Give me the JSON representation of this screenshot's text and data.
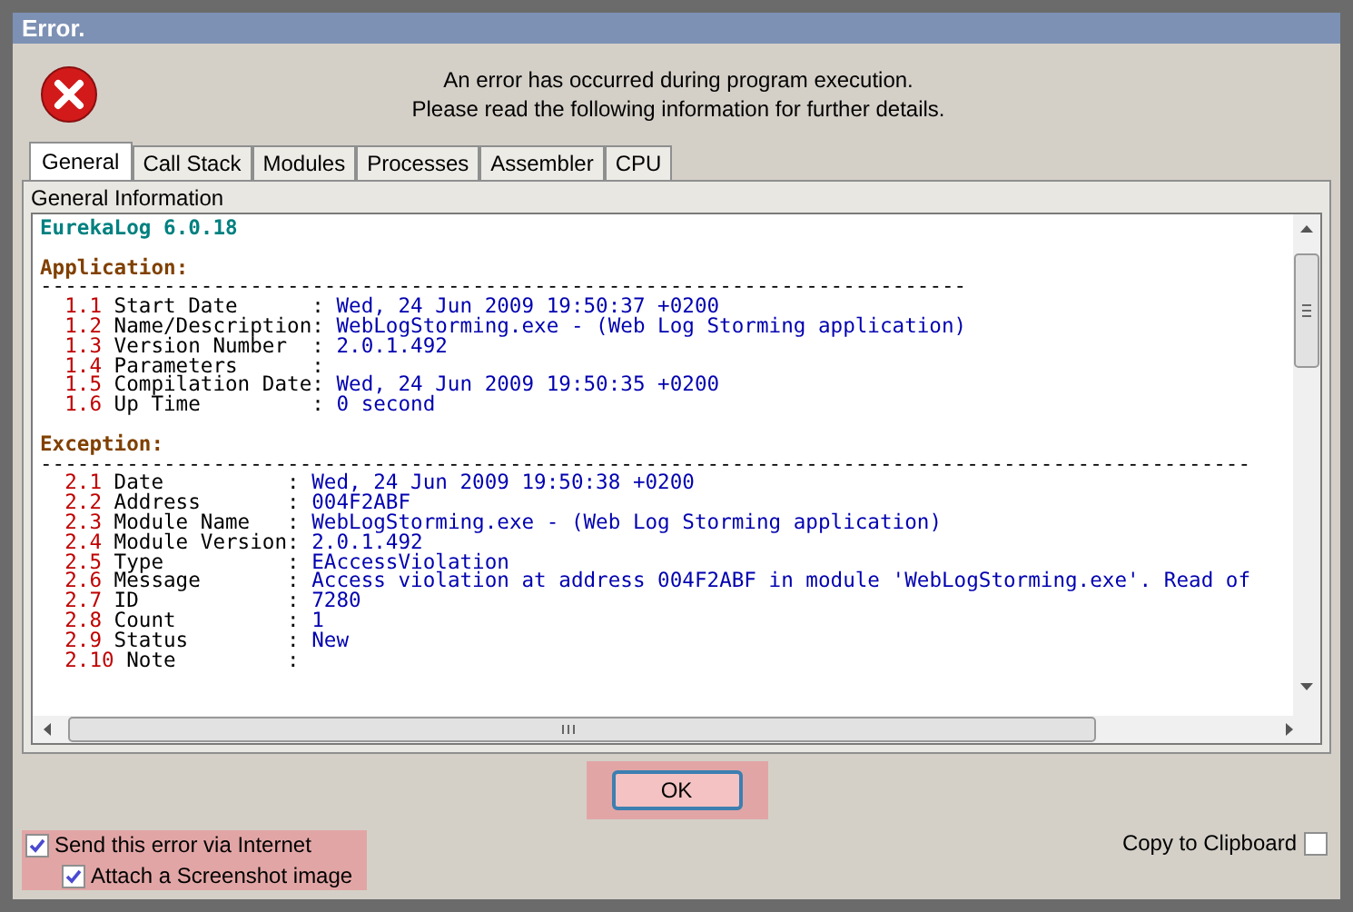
{
  "window": {
    "title": "Error."
  },
  "message": [
    "An error has occurred during program execution.",
    "Please read the following information for further details."
  ],
  "tabs": [
    {
      "label": "General",
      "selected": true
    },
    {
      "label": "Call Stack",
      "selected": false
    },
    {
      "label": "Modules",
      "selected": false
    },
    {
      "label": "Processes",
      "selected": false
    },
    {
      "label": "Assembler",
      "selected": false
    },
    {
      "label": "CPU",
      "selected": false
    }
  ],
  "panel_title": "General Information",
  "log": {
    "title": "EurekaLog 6.0.18",
    "sections": [
      {
        "heading": "Application:",
        "rule": "---------------------------------------------------------------------------",
        "rows": [
          {
            "num": "1.1",
            "label": "Start Date      :",
            "value": "Wed, 24 Jun 2009 19:50:37 +0200"
          },
          {
            "num": "1.2",
            "label": "Name/Description:",
            "value": "WebLogStorming.exe - (Web Log Storming application)"
          },
          {
            "num": "1.3",
            "label": "Version Number  :",
            "value": "2.0.1.492"
          },
          {
            "num": "1.4",
            "label": "Parameters      :",
            "value": ""
          },
          {
            "num": "1.5",
            "label": "Compilation Date:",
            "value": "Wed, 24 Jun 2009 19:50:35 +0200"
          },
          {
            "num": "1.6",
            "label": "Up Time         :",
            "value": "0 second"
          }
        ]
      },
      {
        "heading": "Exception:",
        "rule": "--------------------------------------------------------------------------------------------------",
        "rows": [
          {
            "num": "2.1",
            "label": "Date          :",
            "value": "Wed, 24 Jun 2009 19:50:38 +0200"
          },
          {
            "num": "2.2",
            "label": "Address       :",
            "value": "004F2ABF"
          },
          {
            "num": "2.3",
            "label": "Module Name   :",
            "value": "WebLogStorming.exe - (Web Log Storming application)"
          },
          {
            "num": "2.4",
            "label": "Module Version:",
            "value": "2.0.1.492"
          },
          {
            "num": "2.5",
            "label": "Type          :",
            "value": "EAccessViolation"
          },
          {
            "num": "2.6",
            "label": "Message       :",
            "value": "Access violation at address 004F2ABF in module 'WebLogStorming.exe'. Read of"
          },
          {
            "num": "2.7",
            "label": "ID            :",
            "value": "7280"
          },
          {
            "num": "2.8",
            "label": "Count         :",
            "value": "1"
          },
          {
            "num": "2.9",
            "label": "Status        :",
            "value": "New"
          },
          {
            "num": "2.10",
            "label": "Note         :",
            "value": ""
          }
        ]
      }
    ]
  },
  "ok_button": "OK",
  "options": [
    {
      "label": "Send this error via Internet",
      "checked": true
    },
    {
      "label": "Attach a Screenshot image",
      "checked": true
    }
  ],
  "copy_option": {
    "label": "Copy to Clipboard",
    "checked": false
  }
}
